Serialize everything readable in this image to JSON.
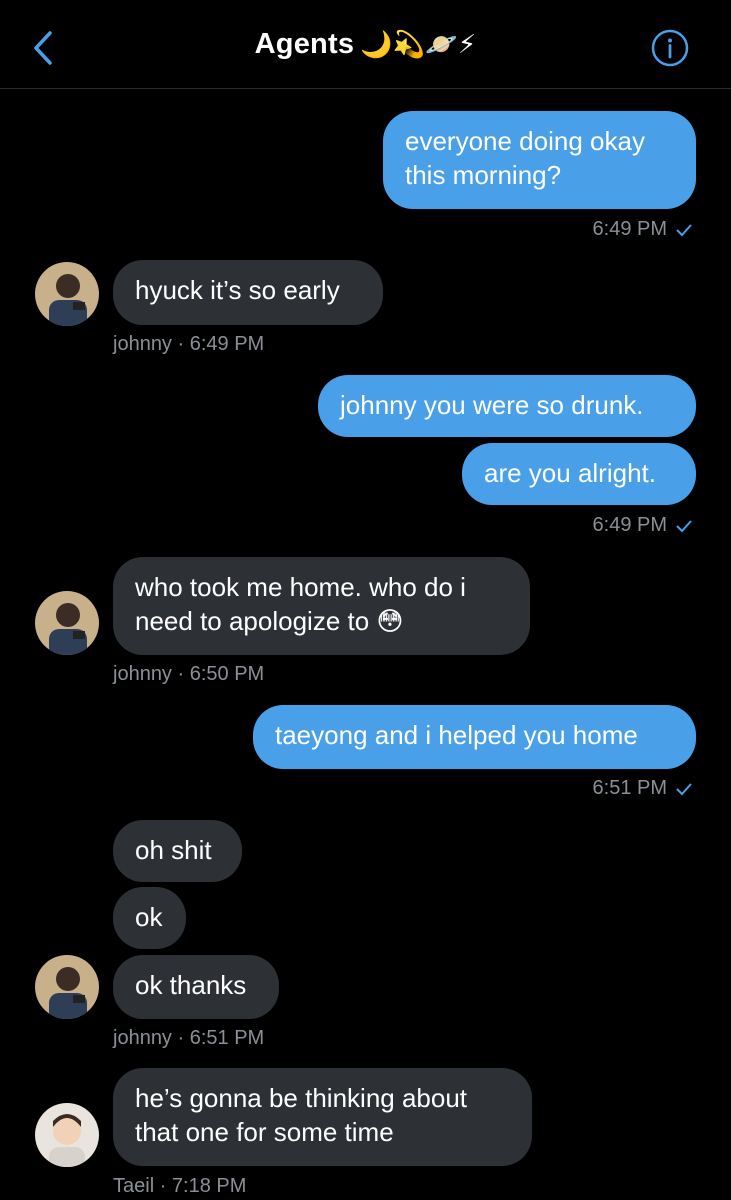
{
  "header": {
    "back_icon": "chevron-left-icon",
    "title": "Agents",
    "title_emoji": "🌙💫🪐⚡",
    "info_icon": "info-icon"
  },
  "colors": {
    "accent": "#4a9fe9",
    "outgoing_bubble": "#4a9fe9",
    "incoming_bubble": "#2d3035",
    "meta_text": "#8b9096",
    "background": "#000000"
  },
  "messages": [
    {
      "direction": "out",
      "text": "everyone doing okay\nthis morning?"
    },
    {
      "direction": "out",
      "meta": "6:49 PM",
      "read": true
    },
    {
      "direction": "in",
      "sender": "johnny",
      "text": "hyuck it’s so early",
      "meta": "johnny · 6:49 PM"
    },
    {
      "direction": "out",
      "text": "johnny you were so drunk."
    },
    {
      "direction": "out",
      "text": "are you alright.",
      "meta": "6:49 PM",
      "read": true
    },
    {
      "direction": "in",
      "sender": "johnny",
      "text": "who took me home. who do i\nneed to apologize to 😳",
      "meta": "johnny · 6:50 PM"
    },
    {
      "direction": "out",
      "text": "taeyong and i helped you home",
      "meta": "6:51 PM",
      "read": true
    },
    {
      "direction": "in",
      "sender": "johnny",
      "text": "oh shit"
    },
    {
      "direction": "in",
      "sender": "johnny",
      "text": "ok"
    },
    {
      "direction": "in",
      "sender": "johnny",
      "text": "ok thanks",
      "meta": "johnny · 6:51 PM"
    },
    {
      "direction": "in",
      "sender": "Taeil",
      "text": "he’s gonna be thinking about\nthat one for some time",
      "meta": "Taeil · 7:18 PM"
    }
  ]
}
